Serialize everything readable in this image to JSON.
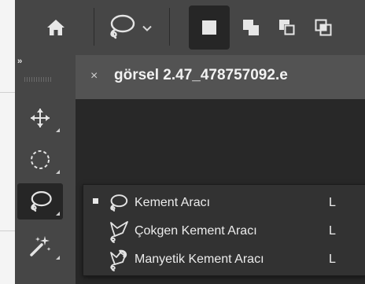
{
  "options_bar": {
    "icons": [
      "home-icon",
      "lasso-icon",
      "chevron-down-icon",
      "new-selection-icon",
      "add-to-selection-icon",
      "subtract-from-selection-icon",
      "intersect-selection-icon"
    ]
  },
  "toolbox": {
    "collapse_label": "››",
    "tools": [
      "move-icon",
      "elliptical-marquee-icon",
      "lasso-icon",
      "magic-wand-icon"
    ],
    "active_tool": "lasso-icon"
  },
  "document_tab": {
    "close_label": "×",
    "title": "görsel 2.47_478757092.e"
  },
  "flyout": {
    "items": [
      {
        "label": "Kement Aracı",
        "shortcut": "L",
        "icon": "lasso-icon",
        "selected": true
      },
      {
        "label": "Çokgen Kement Aracı",
        "shortcut": "L",
        "icon": "polygonal-lasso-icon",
        "selected": false
      },
      {
        "label": "Manyetik Kement Aracı",
        "shortcut": "L",
        "icon": "magnetic-lasso-icon",
        "selected": false
      }
    ]
  },
  "colors": {
    "panel": "#464646",
    "background": "#323232",
    "canvas": "#282828",
    "menu": "#323232",
    "text": "#ececec"
  }
}
